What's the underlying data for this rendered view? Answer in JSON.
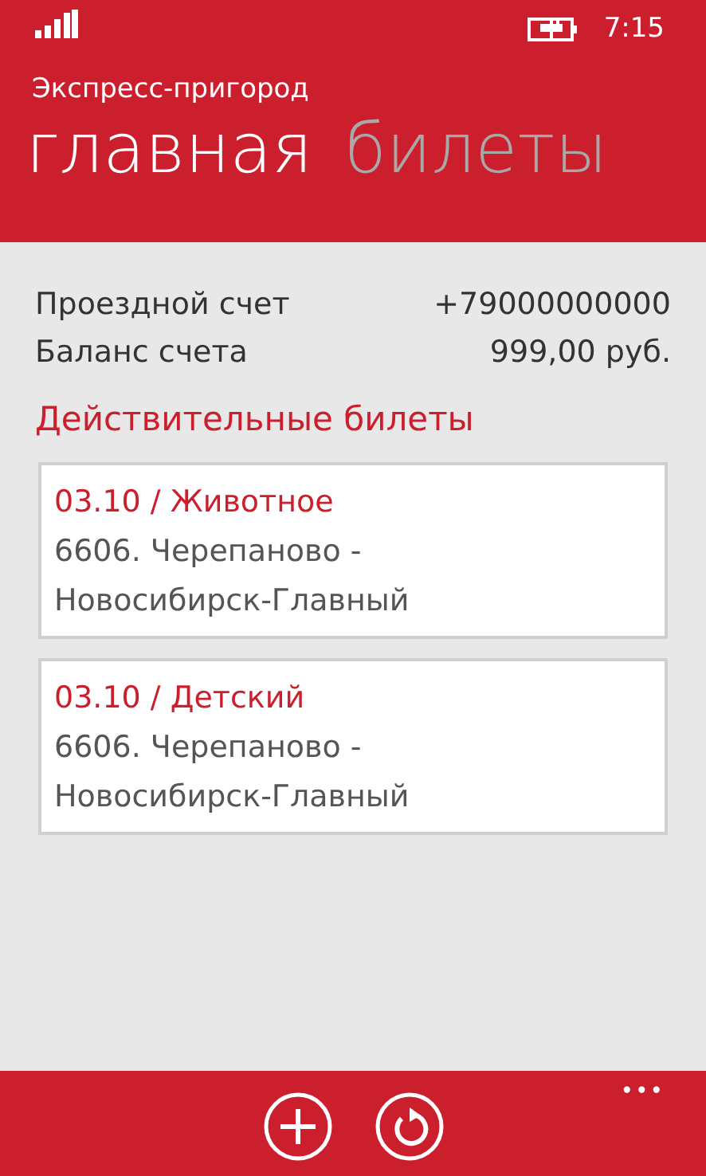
{
  "status_bar": {
    "time": "7:15"
  },
  "app_title": "Экспресс-пригород",
  "tabs": [
    {
      "label": "главная",
      "selected": true
    },
    {
      "label": "билеты",
      "selected": false
    }
  ],
  "account": [
    {
      "label": "Проездной счет",
      "value": "+79000000000"
    },
    {
      "label": "Баланс счета",
      "value": "999,00 руб."
    }
  ],
  "section_title": "Действительные билеты",
  "tickets": [
    {
      "title": "03.10 / Животное",
      "route": "6606. Черепаново - Новосибирск-Главный"
    },
    {
      "title": "03.10 / Детский",
      "route": "6606. Черепаново - Новосибирск-Главный"
    }
  ],
  "app_bar": {
    "buttons": [
      {
        "kind": "add"
      },
      {
        "kind": "refresh"
      }
    ],
    "more": "•••"
  }
}
